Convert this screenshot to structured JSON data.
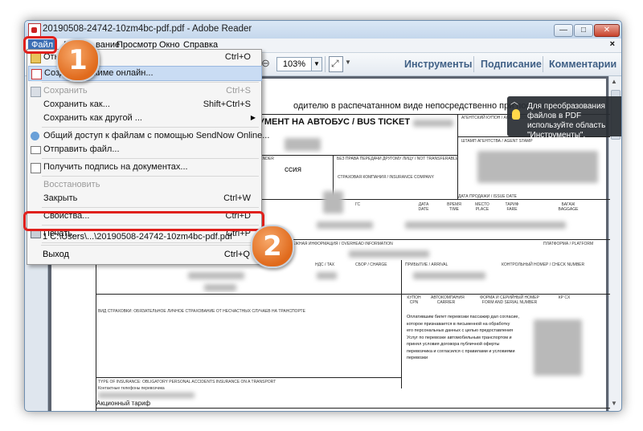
{
  "window": {
    "title": "20190508-24742-10zm4bc-pdf.pdf - Adobe Reader",
    "minimize": "—",
    "maximize": "□",
    "close": "✕"
  },
  "menubar": {
    "items": [
      "Файл",
      "Ре",
      "вание",
      "Просмотр",
      "Окно",
      "Справка"
    ],
    "close_doc": "×"
  },
  "toolbar": {
    "zoom_value": "103%",
    "zoom_arrow": "▼",
    "right_tabs": [
      "Инструменты",
      "Подписание",
      "Комментарии"
    ]
  },
  "file_menu": {
    "items": [
      {
        "label": "Откр",
        "shortcut": "Ctrl+O",
        "icon": "open-folder-icon"
      },
      {
        "label": "Создат... режиме онлайн...",
        "shortcut": "",
        "icon": "create-pdf-icon"
      },
      {
        "label": "Сохранить",
        "shortcut": "Ctrl+S",
        "icon": "save-icon"
      },
      {
        "label": "Сохранить как...",
        "shortcut": "Shift+Ctrl+S",
        "icon": ""
      },
      {
        "label": "Сохранить как другой ...",
        "shortcut": "",
        "icon": ""
      },
      {
        "label": "Общий доступ к файлам с помощью SendNow Online...",
        "shortcut": "",
        "icon": "share-icon"
      },
      {
        "label": "Отправить файл...",
        "shortcut": "",
        "icon": "mail-icon"
      },
      {
        "label": "Получить подпись на документах...",
        "shortcut": "",
        "icon": "sign-icon"
      },
      {
        "label": "Восстановить",
        "shortcut": "",
        "icon": ""
      },
      {
        "label": "Закрыть",
        "shortcut": "Ctrl+W",
        "icon": ""
      },
      {
        "label": "Свойства...",
        "shortcut": "Ctrl+D",
        "icon": ""
      },
      {
        "label": "Печать...",
        "shortcut": "Ctrl+P",
        "icon": "printer-icon"
      },
      {
        "label": "1 C:\\Users\\...\\20190508-24742-10zm4bc-pdf.pdf",
        "shortcut": "",
        "icon": ""
      },
      {
        "label": "Выход",
        "shortcut": "Ctrl+Q",
        "icon": ""
      }
    ]
  },
  "tooltip": {
    "text": "Для преобразования файлов в PDF используйте область \"Инструменты\"."
  },
  "badges": [
    "1",
    "2"
  ],
  "document": {
    "intro": "одителю в распечатанном виде непосредственно при посадке в а",
    "heading": "УМЕНТ НА АВТОБУС / BUS TICKET",
    "agent_coupon": "АГЕНТСКИЙ КУПОН / AGENT COUPON",
    "agent_stamp": "ШТАМП АГЕНТСТВА / AGENT STAMP",
    "sender": "SENDER",
    "transfer_rights": "БЕЗ ПРАВА ПЕРЕДАЧИ ДРУГОМУ ЛИЦУ / NOT TRANSFERABLE",
    "insurance_company": "СТРАХОВАЯ КОМПАНИЯ / INSURANCE COMPANY",
    "issue_date": "ДАТА ПРОДАЖИ / ISSUE DATE",
    "ssia": "ссия",
    "route_cols": [
      "ДАТА DATE",
      "ВРЕМЯ TIME",
      "МЕСТО PLACE",
      "ТАРИФ FARE",
      "БАГАЖ BAGGAGE"
    ],
    "overhead": "ЕЖНАЯ ИНФОРМАЦИЯ / OVERHEAD INFORMATION",
    "platform": "ПЛАТФОРМА / PLATFORM",
    "vat": "НДС / TAX",
    "charge": "СБОР / CHARGE",
    "arrival": "ПРИБЫТИЕ / ARRIVAL",
    "check_number": "КОНТРОЛЬНЫЙ НОМЕР / CHECK NUMBER",
    "coupon_cols": [
      "КУПОН CPN",
      "АВТОКОМПАНИЯ CARRIER",
      "ФОРМА И СЕРИЙНЫЙ НОМЕР FORM AND SERIAL NUMBER",
      "КР CX"
    ],
    "insurance_type_ru": "ВИД СТРАХОВКИ: ОБЯЗАТЕЛЬНОЕ ЛИЧНОЕ СТРАХОВАНИЕ ОТ НЕСЧАСТНЫХ СЛУЧАЕВ НА ТРАНСПОРТЕ",
    "insurance_type_en": "TYPE OF INSURANCE: OBLIGATORY PERSONAL ACCIDENTS INSURANCE ON A TRANSPORT",
    "contact_phones": "Контактные телефоны перевозчика",
    "consent_lines": [
      "Оплатившим билет перевозки пассажир дал согласие,",
      "которое признавается в письменной на обработку",
      "его персональных данных с целью предоставления",
      "Услуг по перевозке автомобильным транспортом и",
      "принял условия договора публичной оферты",
      "перевозчика и согласился с правилами и условиями",
      "перевозки"
    ],
    "tariff": "Акционный тариф"
  }
}
